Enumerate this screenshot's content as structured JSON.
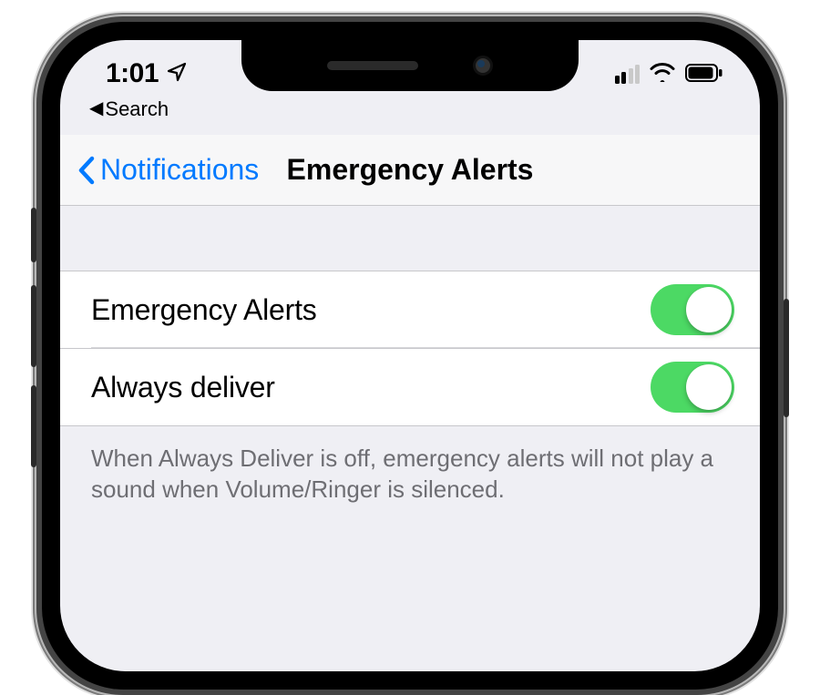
{
  "status": {
    "time": "1:01",
    "signal_bars_active": 2,
    "signal_bars_total": 4
  },
  "back_app": {
    "label": "Search"
  },
  "nav": {
    "back_label": "Notifications",
    "title": "Emergency Alerts"
  },
  "rows": [
    {
      "label": "Emergency Alerts",
      "on": true
    },
    {
      "label": "Always deliver",
      "on": true
    }
  ],
  "footer": "When Always Deliver is off, emergency alerts will not play a sound when Volume/Ringer is silenced.",
  "colors": {
    "link": "#007aff",
    "toggle_on": "#4cd964",
    "bg_grouped": "#efeff4"
  }
}
